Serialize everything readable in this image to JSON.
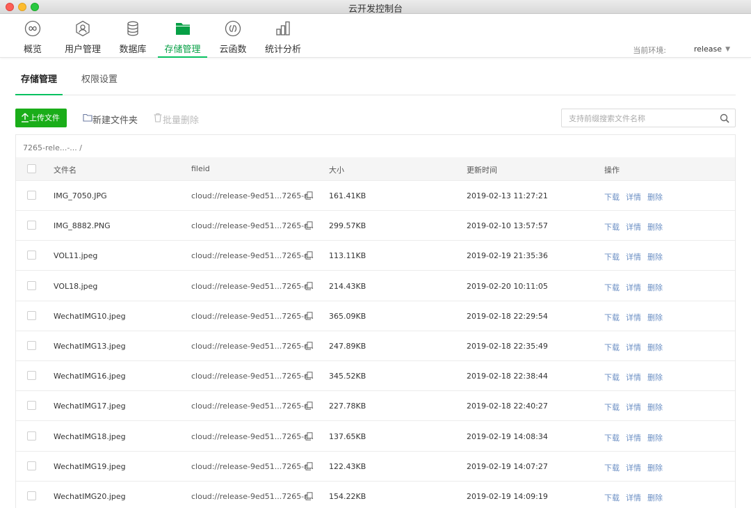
{
  "window": {
    "title": "云开发控制台"
  },
  "nav": {
    "items": [
      {
        "label": "概览",
        "icon": "infinity-icon"
      },
      {
        "label": "用户管理",
        "icon": "user-icon"
      },
      {
        "label": "数据库",
        "icon": "database-icon"
      },
      {
        "label": "存储管理",
        "icon": "folder-icon",
        "active": true
      },
      {
        "label": "云函数",
        "icon": "function-icon"
      },
      {
        "label": "统计分析",
        "icon": "bar-chart-icon"
      }
    ],
    "env_label": "当前环境:",
    "env_value": "release"
  },
  "subtabs": [
    {
      "label": "存储管理",
      "active": true
    },
    {
      "label": "权限设置"
    }
  ],
  "toolbar": {
    "upload_label": "上传文件",
    "new_folder_label": "新建文件夹",
    "batch_delete_label": "批量删除",
    "search_placeholder": "支持前缀搜索文件名称",
    "search_value": ""
  },
  "table": {
    "path": "7265-rele...-... /",
    "columns": [
      "文件名",
      "fileid",
      "大小",
      "更新时间",
      "操作"
    ],
    "actions": [
      "下载",
      "详情",
      "删除"
    ],
    "rows": [
      {
        "name": "IMG_7050.JPG",
        "fileid": "cloud://release-9ed51...7265-r...",
        "size": "161.41KB",
        "time": "2019-02-13 11:27:21"
      },
      {
        "name": "IMG_8882.PNG",
        "fileid": "cloud://release-9ed51...7265-r...",
        "size": "299.57KB",
        "time": "2019-02-10 13:57:57"
      },
      {
        "name": "VOL11.jpeg",
        "fileid": "cloud://release-9ed51...7265-r...",
        "size": "113.11KB",
        "time": "2019-02-19 21:35:36"
      },
      {
        "name": "VOL18.jpeg",
        "fileid": "cloud://release-9ed51...7265-r...",
        "size": "214.43KB",
        "time": "2019-02-20 10:11:05"
      },
      {
        "name": "WechatIMG10.jpeg",
        "fileid": "cloud://release-9ed51...7265-r...",
        "size": "365.09KB",
        "time": "2019-02-18 22:29:54"
      },
      {
        "name": "WechatIMG13.jpeg",
        "fileid": "cloud://release-9ed51...7265-r...",
        "size": "247.89KB",
        "time": "2019-02-18 22:35:49"
      },
      {
        "name": "WechatIMG16.jpeg",
        "fileid": "cloud://release-9ed51...7265-r...",
        "size": "345.52KB",
        "time": "2019-02-18 22:38:44"
      },
      {
        "name": "WechatIMG17.jpeg",
        "fileid": "cloud://release-9ed51...7265-r...",
        "size": "227.78KB",
        "time": "2019-02-18 22:40:27"
      },
      {
        "name": "WechatIMG18.jpeg",
        "fileid": "cloud://release-9ed51...7265-r...",
        "size": "137.65KB",
        "time": "2019-02-19 14:08:34"
      },
      {
        "name": "WechatIMG19.jpeg",
        "fileid": "cloud://release-9ed51...7265-r...",
        "size": "122.43KB",
        "time": "2019-02-19 14:07:27"
      },
      {
        "name": "WechatIMG20.jpeg",
        "fileid": "cloud://release-9ed51...7265-r...",
        "size": "154.22KB",
        "time": "2019-02-19 14:09:19"
      }
    ]
  },
  "colors": {
    "accent_green": "#07c160",
    "upload_green": "#1aad19",
    "link_blue": "#6b8fc4"
  }
}
